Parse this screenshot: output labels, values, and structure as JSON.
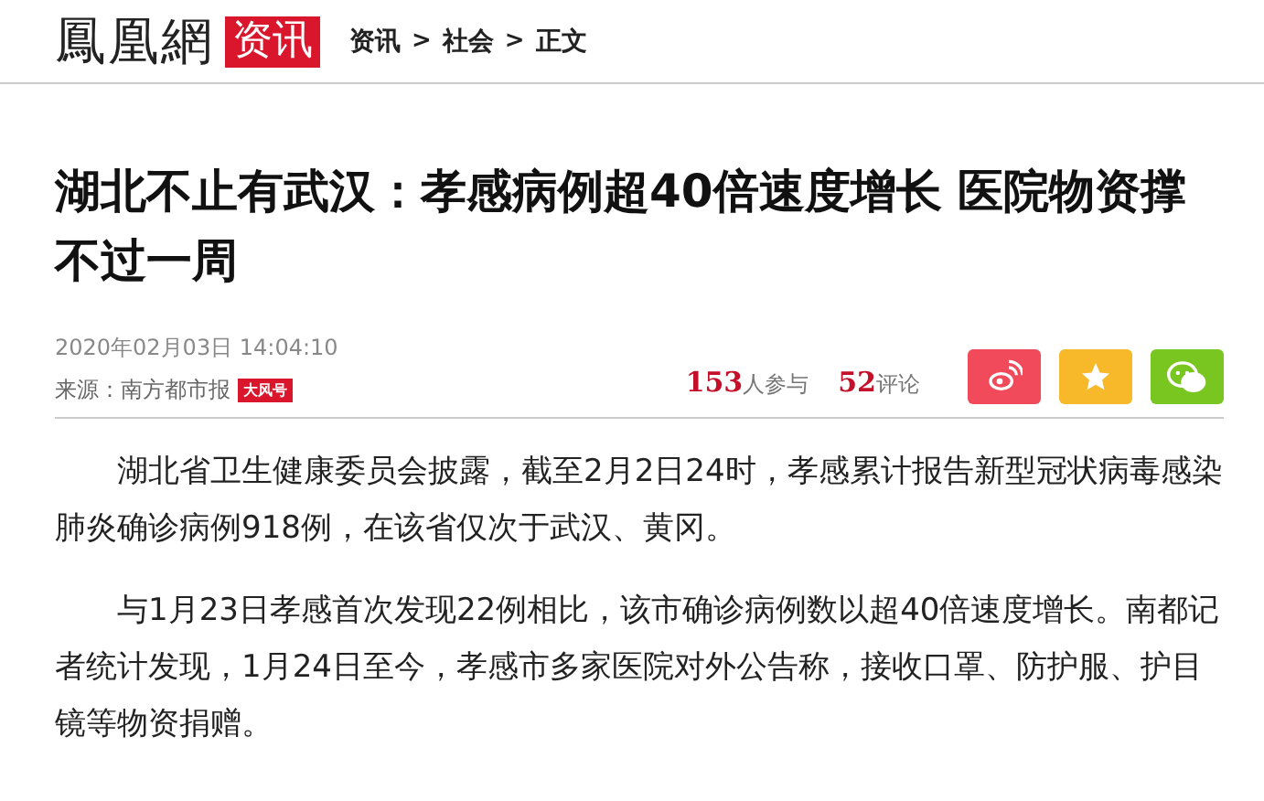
{
  "header": {
    "logo": "鳳凰網",
    "channel": "资讯",
    "breadcrumb": [
      {
        "label": "资讯"
      },
      {
        "label": "社会"
      },
      {
        "label": "正文"
      }
    ],
    "separator": ">"
  },
  "article": {
    "title": "湖北不止有武汉：孝感病例超40倍速度增长 医院物资撑不过一周",
    "date": "2020年02月03日 14:04:10",
    "source": "来源：南方都市报",
    "source_badge": "大风号",
    "stats": [
      {
        "count": "153",
        "label": "人参与"
      },
      {
        "count": "52",
        "label": "评论"
      }
    ],
    "paragraphs": [
      "湖北省卫生健康委员会披露，截至2月2日24时，孝感累计报告新型冠状病毒感染肺炎确诊病例918例，在该省仅次于武汉、黄冈。",
      "与1月23日孝感首次发现22例相比，该市确诊病例数以超40倍速度增长。南都记者统计发现，1月24日至今，孝感市多家医院对外公告称，接收口罩、防护服、护目镜等物资捐赠。"
    ]
  }
}
